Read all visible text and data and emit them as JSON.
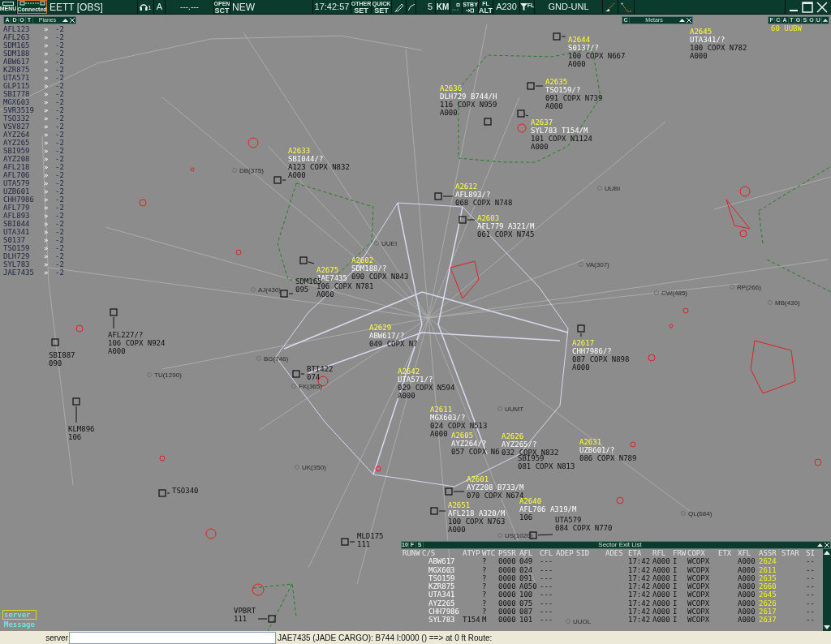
{
  "toolbar": {
    "menu": "MENU",
    "connection": "Connected",
    "position": "EETT [OBS]",
    "headset_count": "1",
    "mode": "A",
    "frequency": "---.---",
    "open_sector": {
      "top": "OPEN",
      "bottom": "SCT"
    },
    "sector": "NEW",
    "time": "17:42:57",
    "other_set": {
      "top": "OTHER",
      "bottom": "SET"
    },
    "quick_set": {
      "top": "QUICK",
      "bottom": "SET"
    },
    "range": "5",
    "range_unit": "KM",
    "stby": "STBY",
    "fl_alt": {
      "top": "FL",
      "bottom": "ALT"
    },
    "altitude": "A230",
    "filter_label": "FL",
    "level_filter": "GND-UNL"
  },
  "planes_panel": {
    "tabs": [
      "A",
      "D",
      "O",
      "T"
    ],
    "title": "Planes",
    "rows": [
      {
        "callsign": "AFL123",
        "arrow": "»",
        "value": "-2"
      },
      {
        "callsign": "AFL263",
        "arrow": "»",
        "value": "-2"
      },
      {
        "callsign": "SDM165",
        "arrow": "»",
        "value": "-2"
      },
      {
        "callsign": "SDM188",
        "arrow": "»",
        "value": "-2"
      },
      {
        "callsign": "ABW617",
        "arrow": "»",
        "value": "-2"
      },
      {
        "callsign": "KZR875",
        "arrow": "»",
        "value": "-2"
      },
      {
        "callsign": "UTA571",
        "arrow": "»",
        "value": "-2"
      },
      {
        "callsign": "GLP115",
        "arrow": "»",
        "value": "-2"
      },
      {
        "callsign": "SBI778",
        "arrow": "»",
        "value": "-2"
      },
      {
        "callsign": "MGX603",
        "arrow": "»",
        "value": "-2"
      },
      {
        "callsign": "SVR3519",
        "arrow": "»",
        "value": "-2"
      },
      {
        "callsign": "TSO332",
        "arrow": "»",
        "value": "-2"
      },
      {
        "callsign": "VSV827",
        "arrow": "»",
        "value": "-2"
      },
      {
        "callsign": "AYZ264",
        "arrow": "»",
        "value": "-2"
      },
      {
        "callsign": "AYZ265",
        "arrow": "»",
        "value": "-2"
      },
      {
        "callsign": "SBI959",
        "arrow": "»",
        "value": "-2"
      },
      {
        "callsign": "AYZ208",
        "arrow": "»",
        "value": "-2"
      },
      {
        "callsign": "AFL218",
        "arrow": "»",
        "value": "-2"
      },
      {
        "callsign": "AFL706",
        "arrow": "»",
        "value": "-2"
      },
      {
        "callsign": "UTA579",
        "arrow": "»",
        "value": "-2"
      },
      {
        "callsign": "UZB601",
        "arrow": "»",
        "value": "-2"
      },
      {
        "callsign": "CHH7986",
        "arrow": "»",
        "value": "-2"
      },
      {
        "callsign": "AFL779",
        "arrow": "»",
        "value": "-2"
      },
      {
        "callsign": "AFL893",
        "arrow": "»",
        "value": "-2"
      },
      {
        "callsign": "SBI044",
        "arrow": "»",
        "value": "-2"
      },
      {
        "callsign": "UTA341",
        "arrow": "»",
        "value": "-2"
      },
      {
        "callsign": "S0137",
        "arrow": "»",
        "value": "-2"
      },
      {
        "callsign": "TSO159",
        "arrow": "»",
        "value": "-2"
      },
      {
        "callsign": "DLH729",
        "arrow": "»",
        "value": "-2"
      },
      {
        "callsign": "SYL783",
        "arrow": "»",
        "value": "-2"
      },
      {
        "callsign": "JAE7435",
        "arrow": "»",
        "value": "-2"
      }
    ]
  },
  "metars_panel": {
    "tab": "C",
    "title": "Metars"
  },
  "weather_panel": {
    "tabs": [
      "F",
      "C",
      "A",
      "T",
      "G",
      "S",
      "O",
      "U"
    ],
    "reading": "60 UUBW"
  },
  "map_labels": [
    "DB(375)",
    "UUEI",
    "UUBI",
    "VA(307)",
    "RP(266)",
    "CW(485)",
    "MB(430)",
    "AJ(430)",
    "BG(746)",
    "TU(1290)",
    "FK(365)",
    "UK(350)",
    "UUMT",
    "QL(684)",
    "US(1020)",
    "UUOL"
  ],
  "aircraft": [
    {
      "code": "A2644",
      "callsign": "S0137/?",
      "lines": [
        "100 COPX N667",
        "A000"
      ]
    },
    {
      "code": "A2645",
      "callsign": "UTA341/?",
      "lines": [
        "100 COPX N782",
        "A000"
      ]
    },
    {
      "code": "A2636",
      "callsign": "DLH729 B744/H",
      "lines": [
        "116 COPX N959",
        "A000"
      ]
    },
    {
      "code": "A2635",
      "callsign": "TSO159/?",
      "lines": [
        "091 COPX N739",
        "A000"
      ]
    },
    {
      "code": "A2637",
      "callsign": "SYL783 T154/M",
      "lines": [
        "101 COPX N1124",
        "A000"
      ]
    },
    {
      "code": "A2633",
      "callsign": "SBI044/?",
      "lines": [
        "A123 COPX N832",
        "A000"
      ]
    },
    {
      "code": "A2612",
      "callsign": "AFL893/?",
      "lines": [
        "068 COPX N748"
      ]
    },
    {
      "code": "A2603",
      "callsign": "AFL779 A321/M",
      "lines": [
        "061 COPX N745"
      ]
    },
    {
      "code": "A2602",
      "callsign": "SDM188/?",
      "lines": [
        "090 COPX N843"
      ]
    },
    {
      "code": "A2675",
      "callsign": "JAE7435",
      "lines": [
        "106 COPX N781",
        "A000"
      ]
    },
    {
      "callsign": "SDM165",
      "lines": [
        "095"
      ]
    },
    {
      "code": "A2629",
      "callsign": "ABW617/?",
      "lines": [
        "049 COPX N7"
      ]
    },
    {
      "callsign": "AFL227/?",
      "lines": [
        "106 COPX N924",
        "A000"
      ]
    },
    {
      "callsign": "SBI887",
      "lines": [
        "090"
      ]
    },
    {
      "code": "A2617",
      "callsign": "CHH7986/?",
      "lines": [
        "087 COPX N898",
        "A000"
      ]
    },
    {
      "callsign": "BTI422",
      "lines": [
        "074"
      ]
    },
    {
      "code": "A2642",
      "callsign": "UTA571/?",
      "lines": [
        "029 COPX N594",
        "A000"
      ]
    },
    {
      "callsign": "KLM896",
      "lines": [
        "106"
      ]
    },
    {
      "code": "A2611",
      "callsign": "MGX603/?",
      "lines": [
        "024 COPX N513",
        "A000"
      ]
    },
    {
      "code": "A2605",
      "callsign": "AYZ264/?",
      "lines": [
        "057 COPX N6"
      ]
    },
    {
      "code": "A2626",
      "callsign": "AYZ265/?",
      "lines": [
        "032 COPX N832"
      ]
    },
    {
      "code": "A2631",
      "callsign": "UZB601/?",
      "lines": [
        "086 COPX N789"
      ]
    },
    {
      "callsign": "SBI959",
      "lines": [
        "081 COPX N813"
      ]
    },
    {
      "callsign": "TSO340"
    },
    {
      "code": "A2601",
      "callsign": "AYZ208 B733/M",
      "lines": [
        "070 COPX N674"
      ]
    },
    {
      "code": "A2651",
      "callsign": "AFL218 A320/M",
      "lines": [
        "100 COPX N763",
        "A000"
      ]
    },
    {
      "code": "A2640",
      "callsign": "AFL706 A319/M",
      "lines": [
        "106"
      ]
    },
    {
      "callsign": "UTA579",
      "lines": [
        "084 COPX N770"
      ]
    },
    {
      "callsign": "MLD175",
      "lines": [
        "111"
      ]
    },
    {
      "callsign": "VPBRT",
      "lines": [
        "111"
      ]
    }
  ],
  "messages_panel": {
    "items": [
      {
        "label": "server",
        "selected": true
      },
      {
        "label": "Message",
        "selected": false
      }
    ]
  },
  "sector_exit_list": {
    "tabs": [
      "10",
      "F",
      "S"
    ],
    "title": "Sector Exit List",
    "columns": [
      "RUNW",
      "C/S",
      "ATYP",
      "WTC",
      "PSSR",
      "AFL",
      "CFL",
      "ADEP",
      "SID",
      "ADES",
      "ETA",
      "RFL",
      "FRW",
      "COPX",
      "ETX",
      "XFL",
      "ASSR",
      "STAR",
      "SI"
    ],
    "rows": [
      {
        "cs": "ABW617",
        "atyp": "",
        "wtc": "?",
        "pssr": "0000",
        "afl": "049",
        "cfl": "---",
        "eta": "17:42",
        "rfl": "A000",
        "fr": "I",
        "copx": "WCOPX",
        "xfl": "A000",
        "assr": "2624",
        "si": "--"
      },
      {
        "cs": "MGX603",
        "atyp": "",
        "wtc": "?",
        "pssr": "0000",
        "afl": "024",
        "cfl": "---",
        "eta": "17:42",
        "rfl": "A000",
        "fr": "I",
        "copx": "WCOPX",
        "xfl": "A000",
        "assr": "2611",
        "si": "--"
      },
      {
        "cs": "TSO159",
        "atyp": "",
        "wtc": "?",
        "pssr": "0000",
        "afl": "091",
        "cfl": "---",
        "eta": "17:42",
        "rfl": "A000",
        "fr": "I",
        "copx": "WCOPX",
        "xfl": "A000",
        "assr": "2635",
        "si": "--"
      },
      {
        "cs": "KZR875",
        "atyp": "",
        "wtc": "?",
        "pssr": "0000",
        "afl": "A050",
        "cfl": "---",
        "eta": "17:42",
        "rfl": "A000",
        "fr": "I",
        "copx": "WCOPX",
        "xfl": "A000",
        "assr": "2660",
        "si": "--"
      },
      {
        "cs": "UTA341",
        "atyp": "",
        "wtc": "?",
        "pssr": "0000",
        "afl": "100",
        "cfl": "---",
        "eta": "17:42",
        "rfl": "A000",
        "fr": "I",
        "copx": "WCOPX",
        "xfl": "A000",
        "assr": "2645",
        "si": "--"
      },
      {
        "cs": "AYZ265",
        "atyp": "",
        "wtc": "?",
        "pssr": "0000",
        "afl": "075",
        "cfl": "---",
        "eta": "17:42",
        "rfl": "A000",
        "fr": "I",
        "copx": "WCOPX",
        "xfl": "A000",
        "assr": "2626",
        "si": "--"
      },
      {
        "cs": "CHH7986",
        "atyp": "",
        "wtc": "?",
        "pssr": "0000",
        "afl": "087",
        "cfl": "---",
        "eta": "17:42",
        "rfl": "A000",
        "fr": "I",
        "copx": "WCOPX",
        "xfl": "A000",
        "assr": "2617",
        "si": "--"
      },
      {
        "cs": "SYL783",
        "atyp": "T154",
        "wtc": "M",
        "pssr": "0000",
        "afl": "101",
        "cfl": "---",
        "eta": "17:42",
        "rfl": "A000",
        "fr": "I",
        "copx": "WCOPX",
        "xfl": "A000",
        "assr": "2637",
        "si": "--"
      }
    ]
  },
  "command_bar": {
    "label": "server",
    "info": "JAE7435 (JADE CARGO): B744 I:0000 () ==> at 0 ft Route:"
  }
}
